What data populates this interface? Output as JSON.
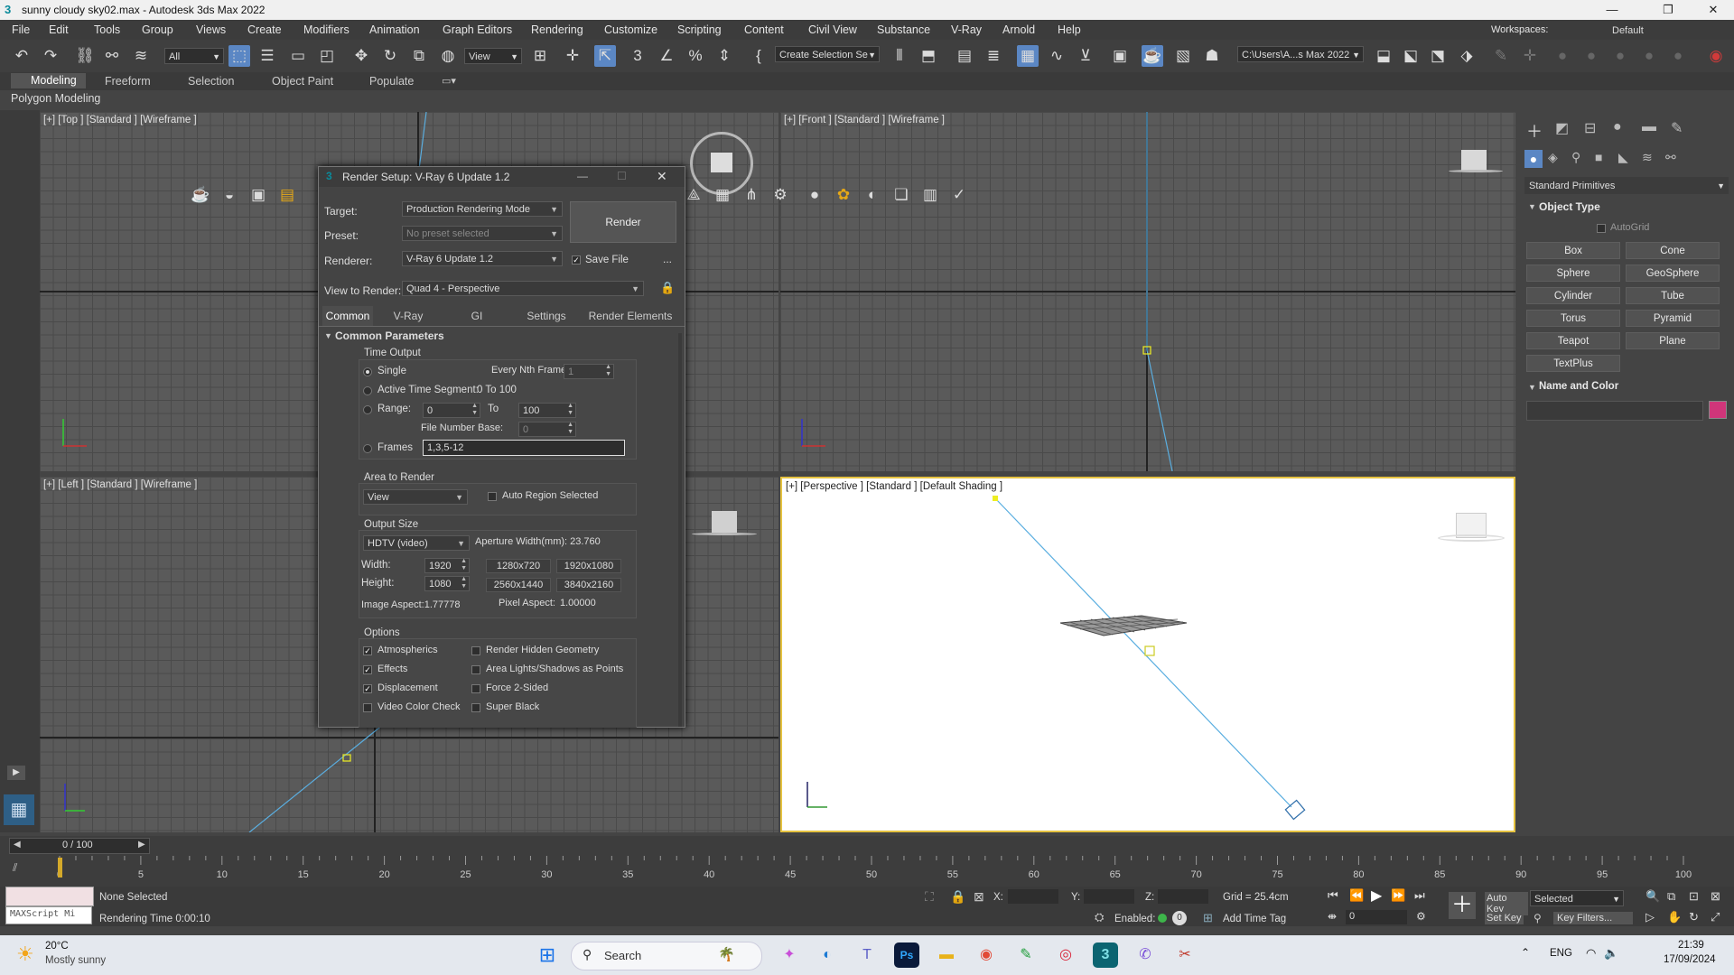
{
  "window": {
    "title": "sunny cloudy sky02.max - Autodesk 3ds Max 2022",
    "controls": [
      "—",
      "❐",
      "✕"
    ]
  },
  "menu": [
    "File",
    "Edit",
    "Tools",
    "Group",
    "Views",
    "Create",
    "Modifiers",
    "Animation",
    "Graph Editors",
    "Rendering",
    "Customize",
    "Scripting",
    "Content",
    "Civil View",
    "Substance",
    "V-Ray",
    "Arnold",
    "Help"
  ],
  "workspace": {
    "label": "Workspaces:",
    "value": "Default"
  },
  "toolbar": {
    "filter_select": "All",
    "view_select": "View",
    "selection_set": "Create Selection Se",
    "path": "C:\\Users\\A...s Max 2022"
  },
  "ribbon": {
    "tabs": [
      "Modeling",
      "Freeform",
      "Selection",
      "Object Paint",
      "Populate"
    ],
    "sub_label": "Polygon Modeling"
  },
  "viewports": {
    "top": "[+] [Top ] [Standard ] [Wireframe ]",
    "front": "[+] [Front ] [Standard ] [Wireframe ]",
    "left": "[+] [Left ] [Standard ] [Wireframe ]",
    "perspective": "[+] [Perspective ] [Standard ] [Default Shading ]"
  },
  "render_setup": {
    "title": "Render Setup: V-Ray 6 Update 1.2",
    "target_label": "Target:",
    "target_value": "Production Rendering Mode",
    "preset_label": "Preset:",
    "preset_value": "No preset selected",
    "renderer_label": "Renderer:",
    "renderer_value": "V-Ray 6 Update 1.2",
    "save_file_label": "Save File",
    "render_button": "Render",
    "more_button": "...",
    "view_label": "View to Render:",
    "view_value": "Quad 4 - Perspective",
    "tabs": [
      "Common",
      "V-Ray",
      "GI",
      "Settings",
      "Render Elements"
    ],
    "rollout": "Common Parameters",
    "time_output": {
      "group": "Time Output",
      "single": "Single",
      "nth_label": "Every Nth Frame:",
      "nth_value": "1",
      "active_label": "Active Time Segment:",
      "active_value": "0 To 100",
      "range_label": "Range:",
      "range_from": "0",
      "to_label": "To",
      "range_to": "100",
      "file_base_label": "File Number Base:",
      "file_base_value": "0",
      "frames_label": "Frames",
      "frames_value": "1,3,5-12"
    },
    "area": {
      "group": "Area to Render",
      "value": "View",
      "auto_region": "Auto Region Selected"
    },
    "output": {
      "group": "Output Size",
      "preset": "HDTV (video)",
      "aperture": "Aperture Width(mm): 23.760",
      "width_label": "Width:",
      "width": "1920",
      "height_label": "Height:",
      "height": "1080",
      "sizes": [
        "1280x720",
        "1920x1080",
        "2560x1440",
        "3840x2160"
      ],
      "aspect": "Image Aspect:1.77778",
      "pixel_aspect_label": "Pixel Aspect:",
      "pixel_aspect": "1.00000"
    },
    "options": {
      "group": "Options",
      "items": [
        {
          "label": "Atmospherics",
          "checked": true
        },
        {
          "label": "Render Hidden Geometry",
          "checked": false
        },
        {
          "label": "Effects",
          "checked": true
        },
        {
          "label": "Area Lights/Shadows as Points",
          "checked": false
        },
        {
          "label": "Displacement",
          "checked": true
        },
        {
          "label": "Force 2-Sided",
          "checked": false
        },
        {
          "label": "Video Color Check",
          "checked": false
        },
        {
          "label": "Super Black",
          "checked": false
        }
      ]
    }
  },
  "command_panel": {
    "dropdown": "Standard Primitives",
    "object_type": "Object Type",
    "autogrid": "AutoGrid",
    "buttons": [
      "Box",
      "Cone",
      "Sphere",
      "GeoSphere",
      "Cylinder",
      "Tube",
      "Torus",
      "Pyramid",
      "Teapot",
      "Plane",
      "TextPlus"
    ],
    "name_color": "Name and Color",
    "swatch_color": "#d0357a"
  },
  "timeline": {
    "slider": "0 / 100",
    "ticks": [
      "0",
      "5",
      "10",
      "15",
      "20",
      "25",
      "30",
      "35",
      "40",
      "45",
      "50",
      "55",
      "60",
      "65",
      "70",
      "75",
      "80",
      "85",
      "90",
      "95",
      "100"
    ]
  },
  "status": {
    "maxscript": "MAXScript Mi",
    "selection": "None Selected",
    "render_time": "Rendering Time  0:00:10",
    "x_label": "X:",
    "y_label": "Y:",
    "z_label": "Z:",
    "grid": "Grid = 25.4cm",
    "enabled": "Enabled:",
    "add_time_tag": "Add Time Tag",
    "frame_value": "0",
    "auto_key": "Auto Key",
    "selected": "Selected",
    "set_key": "Set Key",
    "key_filters": "Key Filters..."
  },
  "taskbar": {
    "temp": "20°C",
    "weather": "Mostly sunny",
    "search": "Search",
    "lang": "ENG",
    "time": "21:39",
    "date": "17/09/2024"
  }
}
